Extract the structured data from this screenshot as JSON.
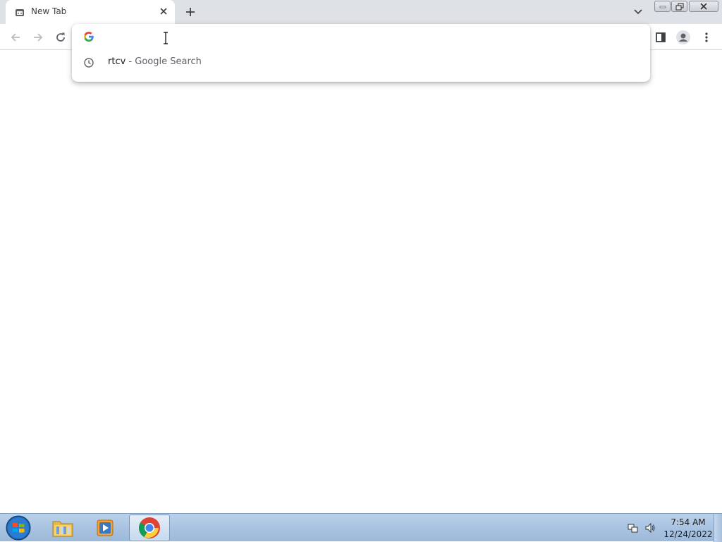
{
  "browser": {
    "tab": {
      "title": "New Tab",
      "favicon": "new-tab-icon"
    },
    "omnibox": {
      "value": "",
      "placeholder": "",
      "suggestions": [
        {
          "query": "rtcv",
          "separator": " - ",
          "description": "Google Search",
          "icon": "history-clock-icon"
        }
      ]
    },
    "colors": {
      "tabstrip": "#dee1e6",
      "accent": "#1a73e8"
    }
  },
  "taskbar": {
    "apps": [
      "Windows Explorer",
      "Windows Media Player",
      "Google Chrome"
    ],
    "clock": {
      "time": "7:54 AM",
      "date": "12/24/2022"
    }
  }
}
